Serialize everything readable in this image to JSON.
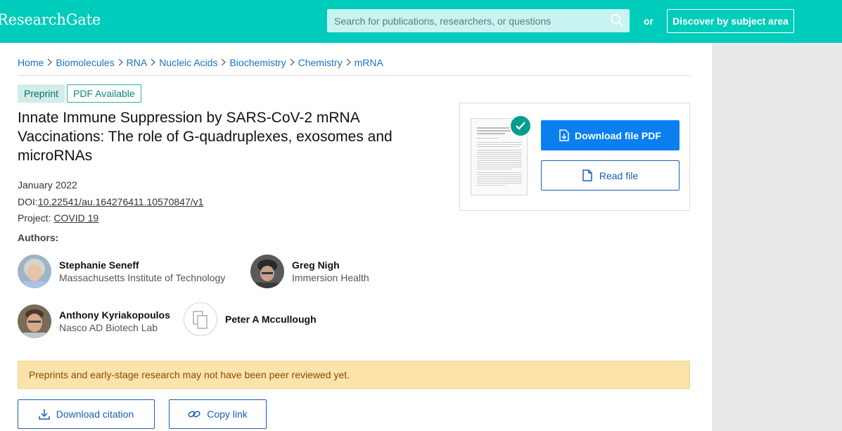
{
  "header": {
    "logo": "ResearchGate",
    "search_placeholder": "Search for publications, researchers, or questions",
    "or_label": "or",
    "discover_label": "Discover by subject area"
  },
  "breadcrumb": [
    "Home",
    "Biomolecules",
    "RNA",
    "Nucleic Acids",
    "Biochemistry",
    "Chemistry",
    "mRNA"
  ],
  "tags": {
    "preprint": "Preprint",
    "pdf_available": "PDF Available"
  },
  "publication": {
    "title": "Innate Immune Suppression by SARS-CoV-2 mRNA Vaccinations: The role of G-quadruplexes, exosomes and microRNAs",
    "date": "January 2022",
    "doi_label": "DOI:",
    "doi": "10.22541/au.164276411.10570847/v1",
    "project_label": "Project:",
    "project": "COVID 19"
  },
  "authors_label": "Authors:",
  "authors": [
    {
      "name": "Stephanie Seneff",
      "institution": "Massachusetts Institute of Technology"
    },
    {
      "name": "Greg Nigh",
      "institution": "Immersion Health"
    },
    {
      "name": "Anthony Kyriakopoulos",
      "institution": "Nasco AD Biotech Lab"
    },
    {
      "name": "Peter A Mccullough",
      "institution": ""
    }
  ],
  "notice": "Preprints and early-stage research may not have been peer reviewed yet.",
  "actions": {
    "download_citation": "Download citation",
    "copy_link": "Copy link"
  },
  "pdf_card": {
    "download_pdf": "Download file PDF",
    "read_file": "Read file"
  },
  "colors": {
    "brand": "#00ccbb",
    "primary_button": "#0a7ff0",
    "link": "#1a73c8",
    "notice_bg": "#fbe3a9"
  }
}
